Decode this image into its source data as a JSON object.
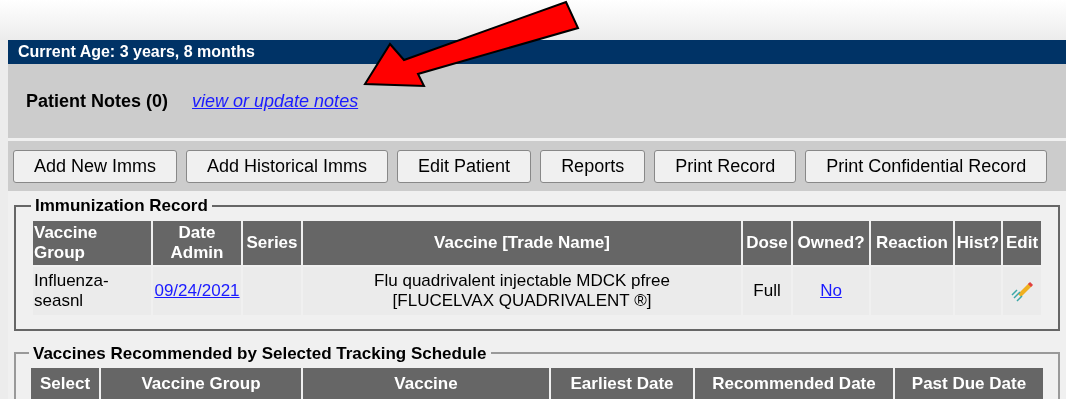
{
  "age_bar": {
    "text": "Current Age: 3 years, 8 months"
  },
  "patient_notes": {
    "label": "Patient Notes (0)",
    "link": "view or update notes"
  },
  "buttons": [
    "Add New Imms",
    "Add Historical Imms",
    "Edit Patient",
    "Reports",
    "Print Record",
    "Print Confidential Record"
  ],
  "immunization_record": {
    "legend": "Immunization Record",
    "columns": [
      "Vaccine Group",
      "Date Admin",
      "Series",
      "Vaccine [Trade Name]",
      "Dose",
      "Owned?",
      "Reaction",
      "Hist?",
      "Edit"
    ],
    "rows": [
      {
        "vaccine_group": "Influenza-seasnl",
        "date_admin": "09/24/2021",
        "vaccine": "Flu quadrivalent injectable MDCK pfree [FLUCELVAX QUADRIVALENT ®]",
        "dose": "Full",
        "owned": "No"
      }
    ]
  },
  "recommended": {
    "legend": "Vaccines Recommended by Selected Tracking Schedule",
    "columns": [
      "Select",
      "Vaccine Group",
      "Vaccine",
      "Earliest Date",
      "Recommended Date",
      "Past Due Date"
    ]
  }
}
